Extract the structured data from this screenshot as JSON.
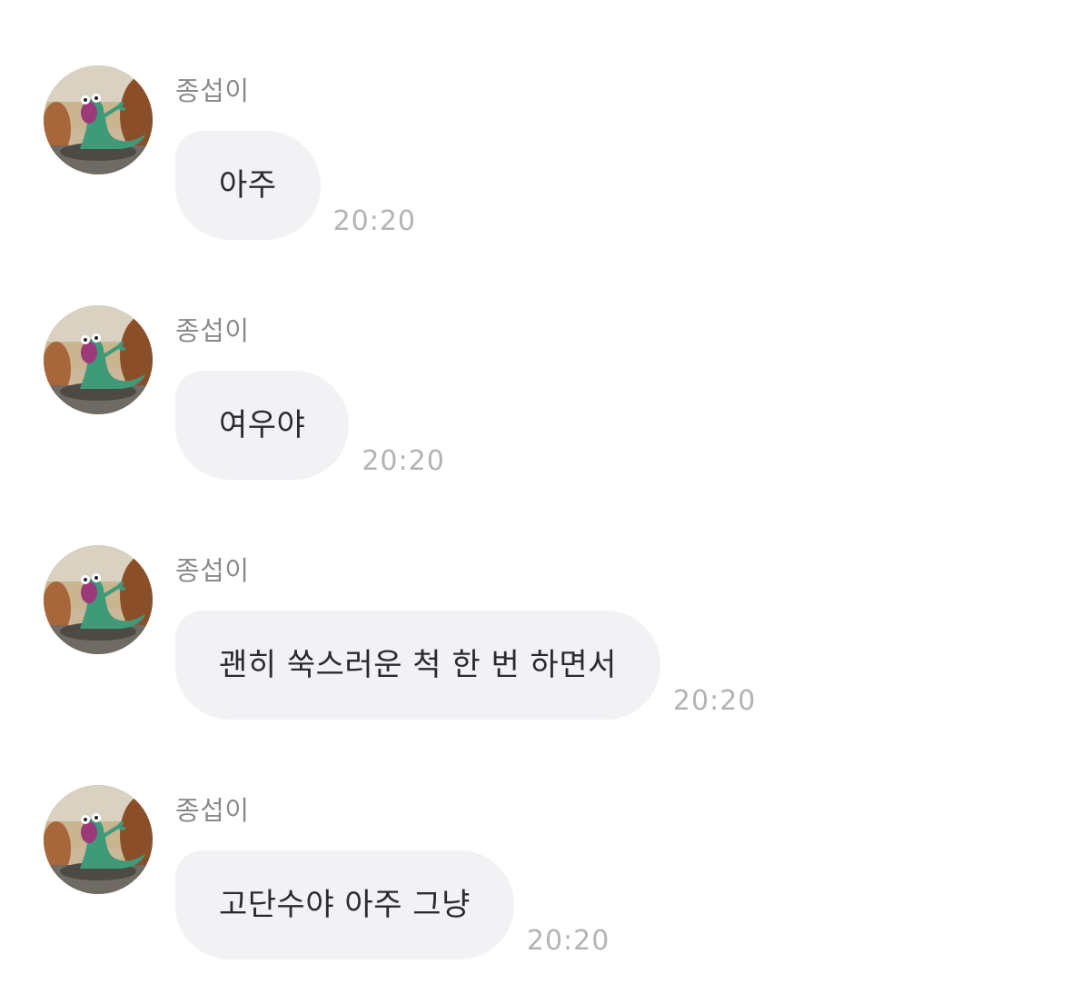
{
  "messages": [
    {
      "sender": "종섭이",
      "text": "아주",
      "time": "20:20"
    },
    {
      "sender": "종섭이",
      "text": "여우야",
      "time": "20:20"
    },
    {
      "sender": "종섭이",
      "text": "괜히 쑥스러운 척 한 번 하면서",
      "time": "20:20"
    },
    {
      "sender": "종섭이",
      "text": "고단수야 아주 그냥",
      "time": "20:20"
    }
  ],
  "avatar": {
    "icon": "lizard-avatar-icon",
    "colors": {
      "sky": "#d9d2c2",
      "rock": "#9a5a2e",
      "lizard": "#3f9a7a",
      "ground": "#6f6a63"
    }
  }
}
